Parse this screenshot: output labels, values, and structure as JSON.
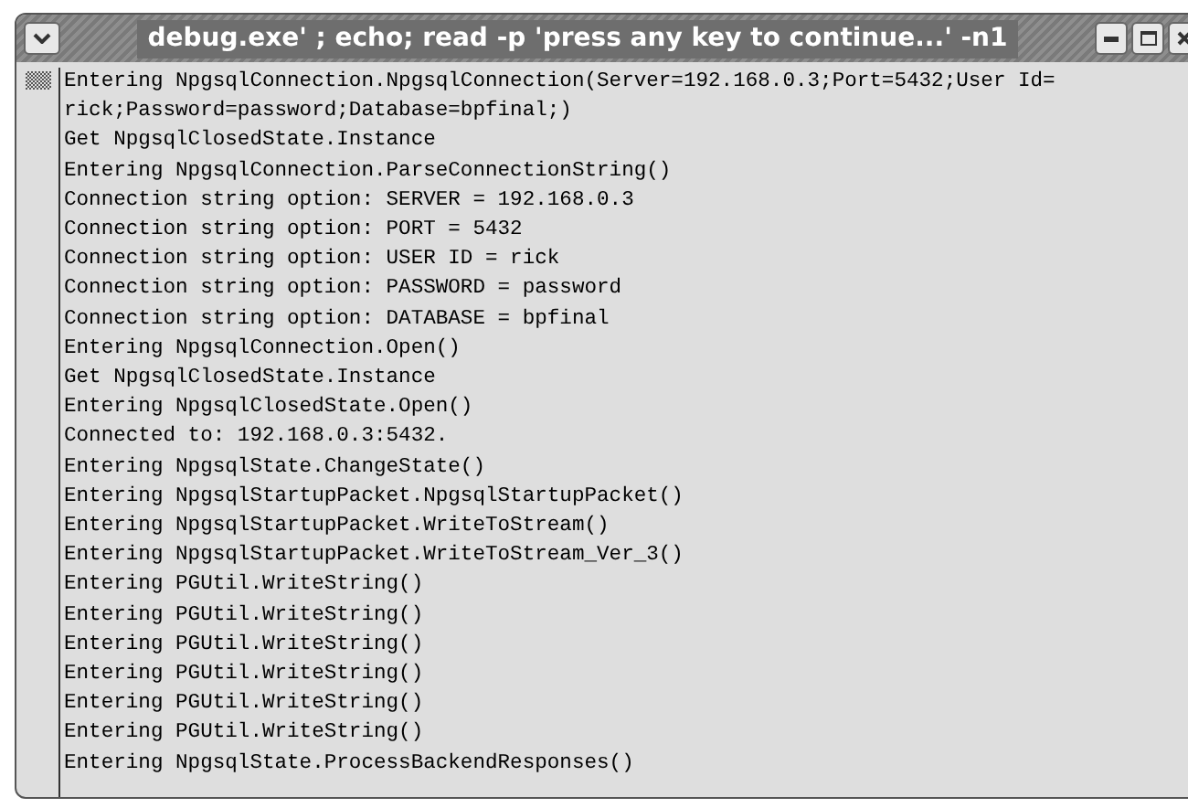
{
  "window": {
    "title": "debug.exe' ; echo; read -p 'press any key to continue...' -n1"
  },
  "terminal": {
    "lines": [
      "Entering NpgsqlConnection.NpgsqlConnection(Server=192.168.0.3;Port=5432;User Id=",
      "rick;Password=password;Database=bpfinal;)",
      "Get NpgsqlClosedState.Instance",
      "Entering NpgsqlConnection.ParseConnectionString()",
      "Connection string option: SERVER = 192.168.0.3",
      "Connection string option: PORT = 5432",
      "Connection string option: USER ID = rick",
      "Connection string option: PASSWORD = password",
      "Connection string option: DATABASE = bpfinal",
      "Entering NpgsqlConnection.Open()",
      "Get NpgsqlClosedState.Instance",
      "Entering NpgsqlClosedState.Open()",
      "Connected to: 192.168.0.3:5432.",
      "Entering NpgsqlState.ChangeState()",
      "Entering NpgsqlStartupPacket.NpgsqlStartupPacket()",
      "Entering NpgsqlStartupPacket.WriteToStream()",
      "Entering NpgsqlStartupPacket.WriteToStream_Ver_3()",
      "Entering PGUtil.WriteString()",
      "Entering PGUtil.WriteString()",
      "Entering PGUtil.WriteString()",
      "Entering PGUtil.WriteString()",
      "Entering PGUtil.WriteString()",
      "Entering PGUtil.WriteString()",
      "Entering NpgsqlState.ProcessBackendResponses()"
    ]
  }
}
